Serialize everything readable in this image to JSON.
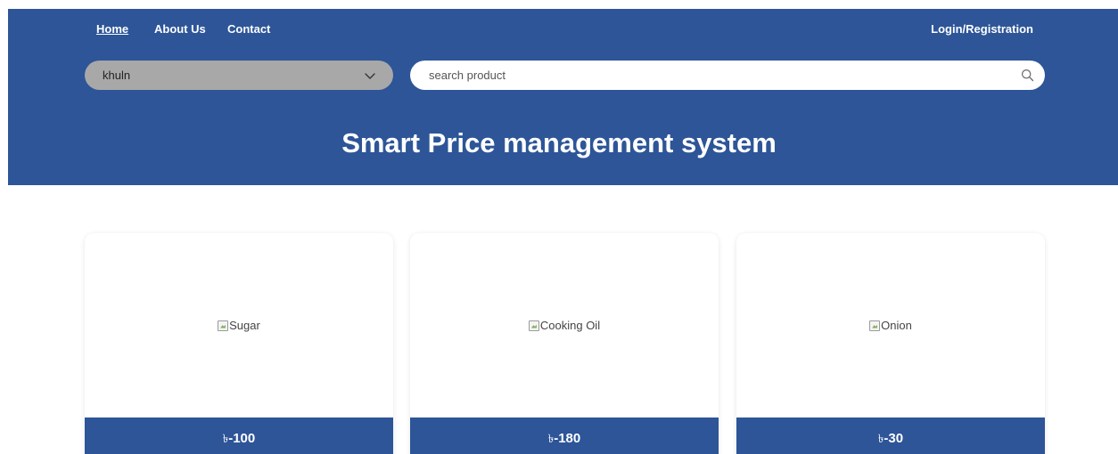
{
  "nav": {
    "links": [
      {
        "label": "Home",
        "active": true
      },
      {
        "label": "About Us",
        "active": false
      },
      {
        "label": "Contact",
        "active": false
      }
    ],
    "login_label": "Login/Registration"
  },
  "filters": {
    "location_value": "khuln",
    "search_placeholder": "search product",
    "search_value": ""
  },
  "hero": {
    "title": "Smart Price management system"
  },
  "products": [
    {
      "name": "Sugar",
      "currency": "৳",
      "price": "-100"
    },
    {
      "name": "Cooking Oil",
      "currency": "৳",
      "price": "-180"
    },
    {
      "name": "Onion",
      "currency": "৳",
      "price": "-30"
    }
  ],
  "colors": {
    "primary": "#2d5598",
    "select_bg": "#a8a8a8",
    "background": "#ffffff"
  },
  "icons": {
    "dropdown": "chevron-down-icon",
    "search": "search-icon",
    "broken_image": "broken-image-icon"
  }
}
